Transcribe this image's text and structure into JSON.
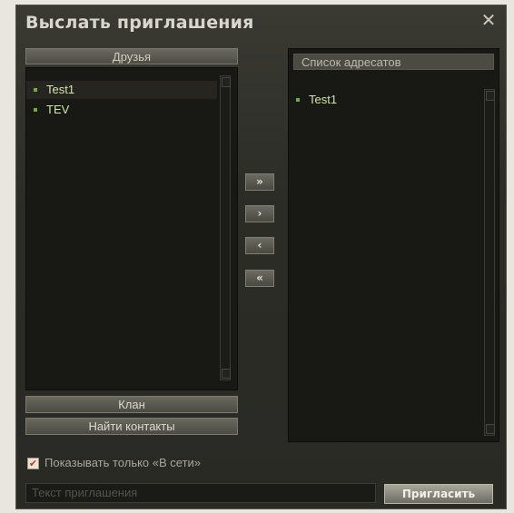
{
  "dialog": {
    "title": "Выслать приглашения",
    "close_glyph": "✕"
  },
  "friends": {
    "header": "Друзья",
    "items": [
      {
        "label": "Test1",
        "selected": true
      },
      {
        "label": "TEV",
        "selected": false
      }
    ]
  },
  "recipients": {
    "header": "Список адресатов",
    "items": [
      {
        "label": "Test1"
      }
    ]
  },
  "move_buttons": {
    "add_all": "»",
    "add": "›",
    "remove": "‹",
    "remove_all": "«"
  },
  "buttons": {
    "clan": "Клан",
    "find_contacts": "Найти контакты",
    "invite": "Пригласить"
  },
  "online_only": {
    "label": "Показывать только «В сети»",
    "checked": true,
    "check_glyph": "✔"
  },
  "message_input": {
    "placeholder": "Текст приглашения",
    "value": ""
  },
  "colors": {
    "online_dot": "#6fae3a",
    "checkmark": "#c0392b"
  }
}
